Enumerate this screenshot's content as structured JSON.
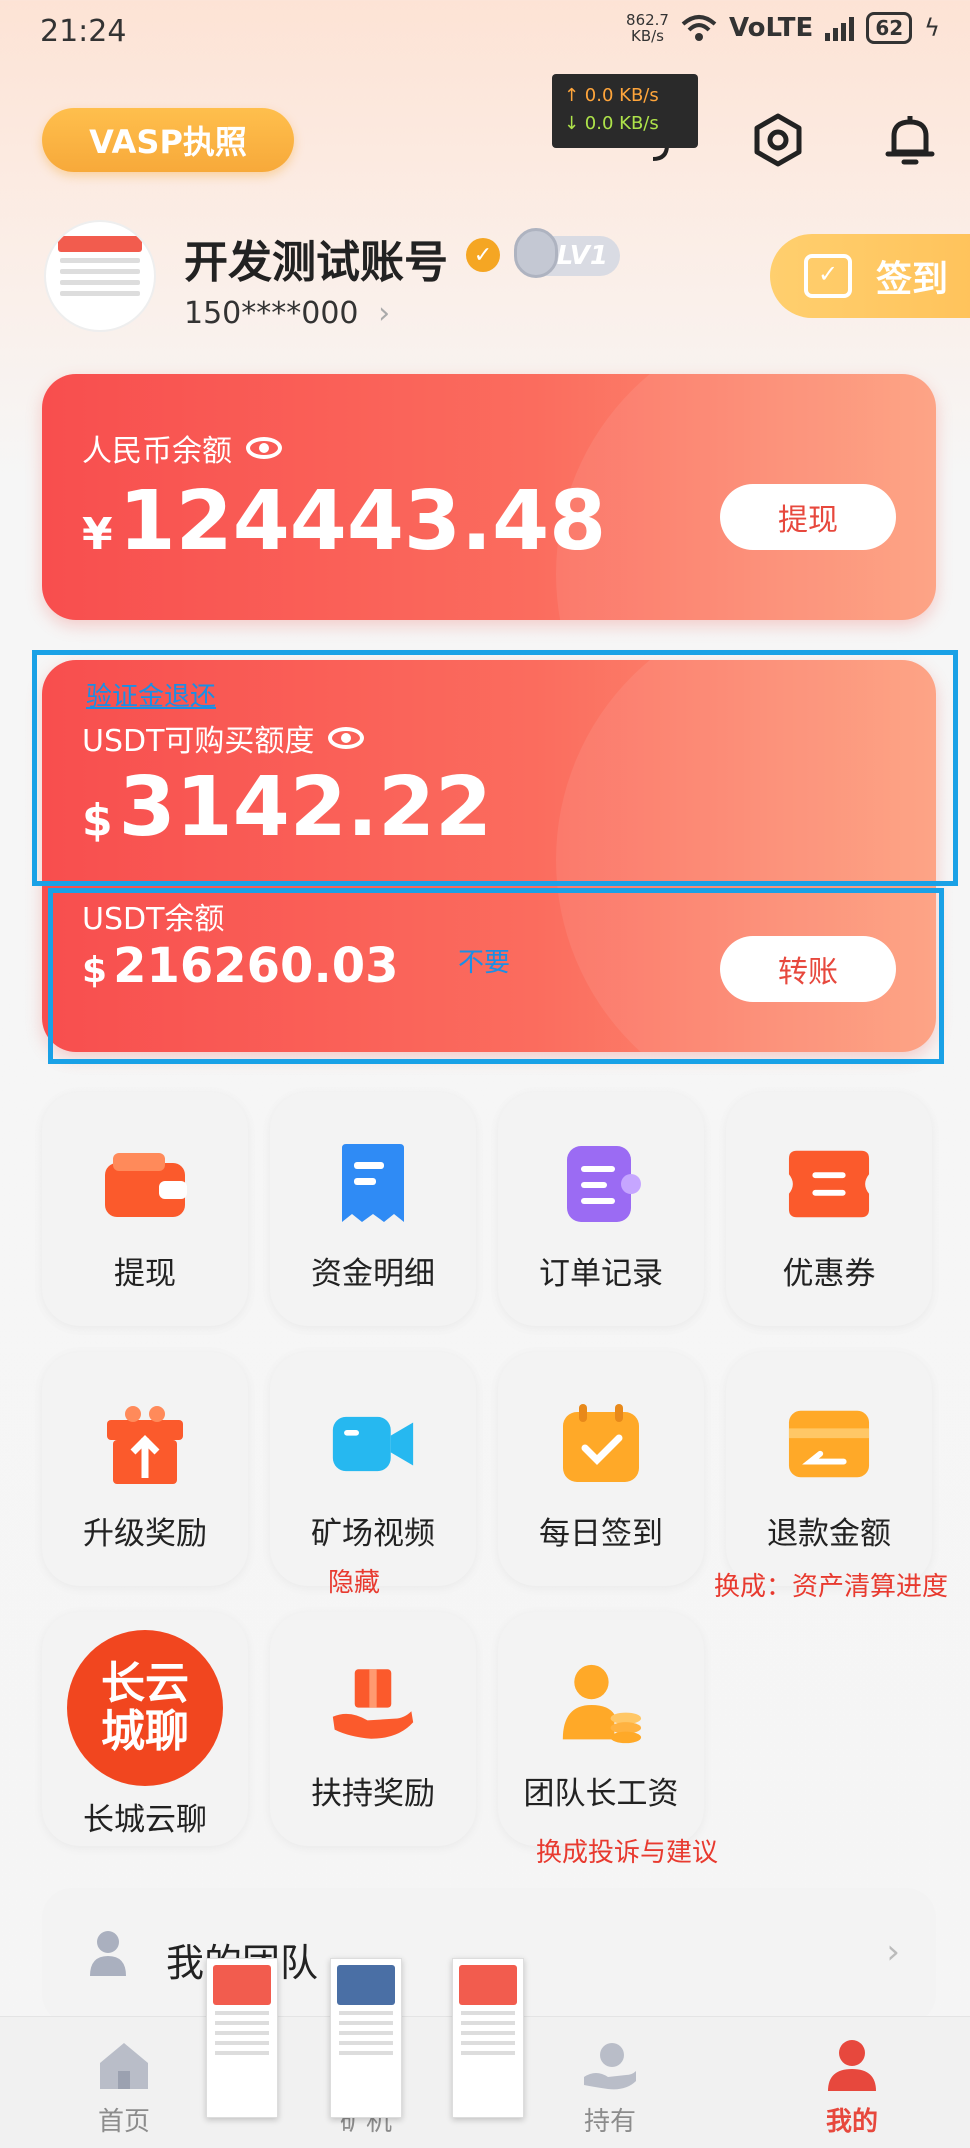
{
  "status_bar": {
    "time": "21:24",
    "net_speed_value": "862.7",
    "net_speed_unit": "KB/s",
    "network": "VoLTE",
    "battery": "62"
  },
  "net_overlay": {
    "up": "↑ 0.0 KB/s",
    "down": "↓ 0.0 KB/s"
  },
  "header": {
    "vasp_label": "VASP执照",
    "username": "开发测试账号",
    "level": "LV1",
    "phone": "150****000",
    "signin_label": "签到"
  },
  "cards": {
    "rmb": {
      "label": "人民币余额",
      "currency": "¥",
      "amount": "124443.48",
      "action": "提现"
    },
    "usdt_quota": {
      "label": "USDT可购买额度",
      "currency": "$",
      "amount": "3142.22"
    },
    "usdt_balance": {
      "label": "USDT余额",
      "currency": "$",
      "amount": "216260.03",
      "action": "转账"
    }
  },
  "annotations": {
    "deposit_refund": "验证金退还",
    "not_needed": "不要",
    "hide": "隐藏",
    "replace_progress": "换成：资产清算进度",
    "replace_complaint": "换成投诉与建议"
  },
  "grid": [
    {
      "label": "提现",
      "icon": "wallet-icon",
      "color": "#fb5a2c"
    },
    {
      "label": "资金明细",
      "icon": "receipt-icon",
      "color": "#2f8bf5"
    },
    {
      "label": "订单记录",
      "icon": "order-list-icon",
      "color": "#9b6bf3"
    },
    {
      "label": "优惠券",
      "icon": "coupon-icon",
      "color": "#fb5a2c"
    },
    {
      "label": "升级奖励",
      "icon": "gift-box-icon",
      "color": "#fb5a2c"
    },
    {
      "label": "矿场视频",
      "icon": "video-camera-icon",
      "color": "#26b8f0"
    },
    {
      "label": "每日签到",
      "icon": "calendar-check-icon",
      "color": "#ffa928"
    },
    {
      "label": "退款金额",
      "icon": "refund-card-icon",
      "color": "#ffa928"
    },
    {
      "label": "长城云聊",
      "icon": "greatwall-chat-logo",
      "color": "#f1461f",
      "logo_text": "长云城聊"
    },
    {
      "label": "扶持奖励",
      "icon": "hand-gift-icon",
      "color": "#fb5a2c"
    },
    {
      "label": "团队长工资",
      "icon": "leader-salary-icon",
      "color": "#ffa928"
    }
  ],
  "team": {
    "label": "我的团队"
  },
  "nav": [
    {
      "label": "首页",
      "icon": "home-icon"
    },
    {
      "label": "矿机",
      "icon": "miner-icon"
    },
    {
      "label": "持有",
      "icon": "holdings-icon"
    },
    {
      "label": "我的",
      "icon": "profile-icon",
      "active": true
    }
  ],
  "colors": {
    "accent": "#e7483d",
    "card_start": "#f84e4e",
    "card_end": "#fd9d7c",
    "annotation_blue": "#1aa1e6",
    "annotation_red": "#e83a2f",
    "vasp_gold": "#f7a93a"
  }
}
